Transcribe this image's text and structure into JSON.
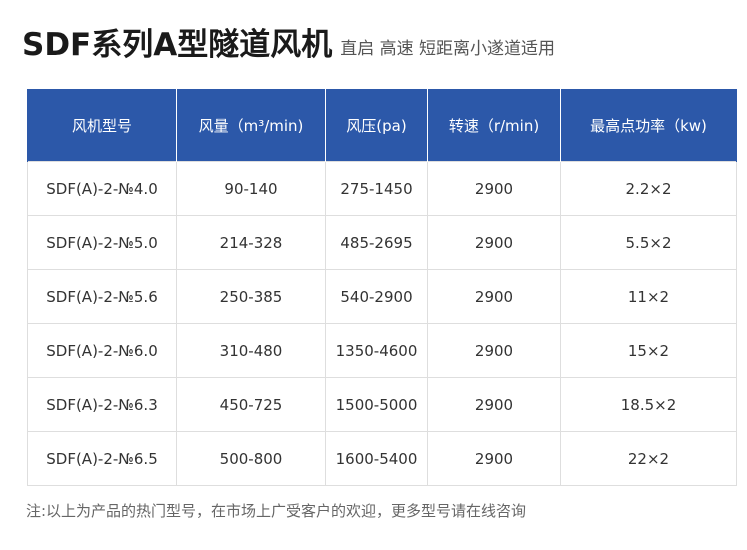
{
  "header": {
    "title": "SDF系列A型隧道风机",
    "subtitle": "直启 高速 短距离小遂道适用"
  },
  "table": {
    "columns": [
      "风机型号",
      "风量（m³/min)",
      "风压(pa)",
      "转速（r/min)",
      "最高点功率（kw)"
    ],
    "rows": [
      [
        "SDF(A)-2-№4.0",
        "90-140",
        "275-1450",
        "2900",
        "2.2×2"
      ],
      [
        "SDF(A)-2-№5.0",
        "214-328",
        "485-2695",
        "2900",
        "5.5×2"
      ],
      [
        "SDF(A)-2-№5.6",
        "250-385",
        "540-2900",
        "2900",
        "11×2"
      ],
      [
        "SDF(A)-2-№6.0",
        "310-480",
        "1350-4600",
        "2900",
        "15×2"
      ],
      [
        "SDF(A)-2-№6.3",
        "450-725",
        "1500-5000",
        "2900",
        "18.5×2"
      ],
      [
        "SDF(A)-2-№6.5",
        "500-800",
        "1600-5400",
        "2900",
        "22×2"
      ]
    ]
  },
  "footer": {
    "note": "注:以上为产品的热门型号，在市场上广受客户的欢迎，更多型号请在线咨询"
  },
  "colors": {
    "header_bg": "#2c58a9",
    "header_text": "#ffffff",
    "border": "#dedede"
  }
}
